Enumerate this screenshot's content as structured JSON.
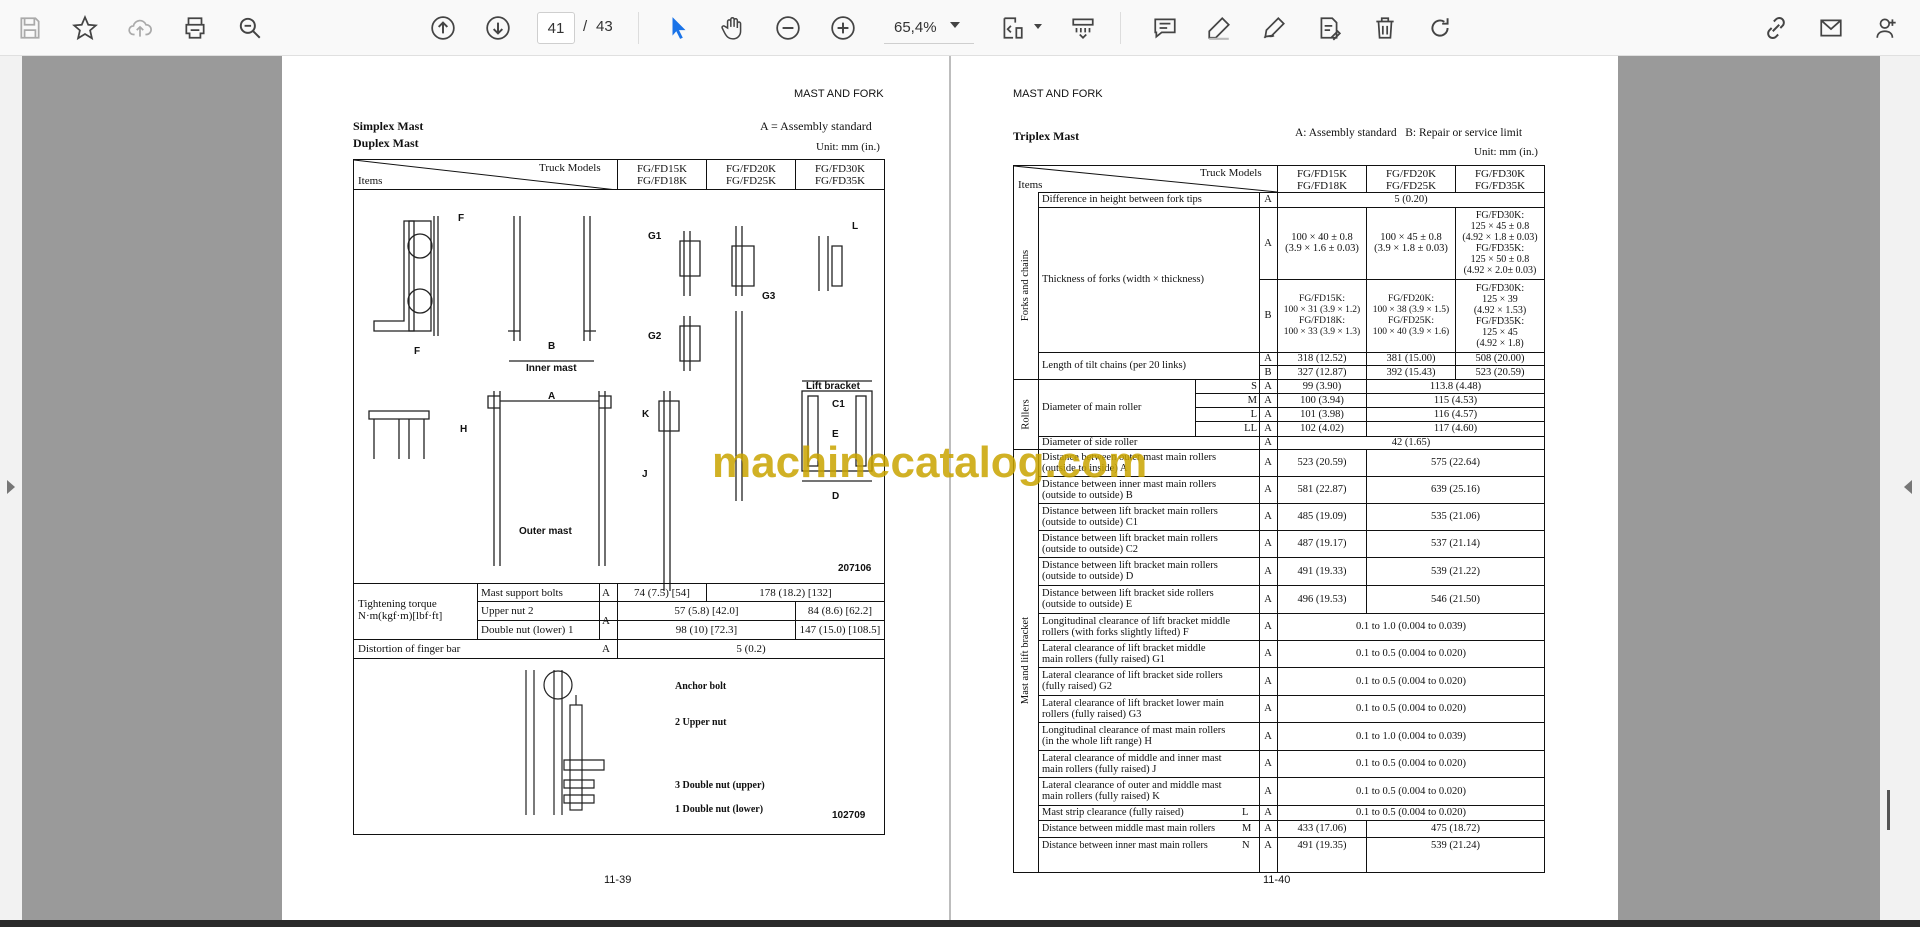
{
  "toolbar": {
    "page_current": "41",
    "page_separator": "/",
    "page_total": "43",
    "zoom": "65,4%"
  },
  "left_page": {
    "header": "MAST AND FORK",
    "title1": "Simplex Mast",
    "title2": "Duplex Mast",
    "std": "A = Assembly standard",
    "unit": "Unit: mm (in.)",
    "col_truck": "Truck Models",
    "col_items": "Items",
    "models": [
      [
        "FG/FD15K",
        "FG/FD18K"
      ],
      [
        "FG/FD20K",
        "FG/FD25K"
      ],
      [
        "FG/FD30K",
        "FG/FD35K"
      ]
    ],
    "fig_labels": {
      "F1": "F",
      "F2": "F",
      "B": "B",
      "inner": "Inner mast",
      "G1": "G1",
      "G3": "G3",
      "G2": "G2",
      "L": "L",
      "lift": "Lift bracket",
      "C1": "C1",
      "E": "E",
      "D": "D",
      "A": "A",
      "H": "H",
      "K": "K",
      "J": "J",
      "outer": "Outer mast",
      "code": "207106"
    },
    "torque_label": [
      "Tightening torque",
      "N·m(kgf·m)[lbf·ft]"
    ],
    "torque_rows": [
      {
        "name": "Mast support bolts",
        "std": "A",
        "v1": "74 (7.5) [54]",
        "v2": "178 (18.2) [132]"
      },
      {
        "name": "Upper nut 2",
        "std": "A",
        "v1": "57 (5.8) [42.0]",
        "v2": "84 (8.6) [62.2]"
      },
      {
        "name": "Double nut (lower) 1",
        "std": "",
        "v1": "98 (10) [72.3]",
        "v2": "147 (15.0) [108.5]"
      }
    ],
    "distortion": {
      "name": "Distortion of finger bar",
      "std": "A",
      "value": "5 (0.2)"
    },
    "fig2": {
      "anchor": "Anchor bolt",
      "upper": "2 Upper nut",
      "dn_upper": "3 Double nut (upper)",
      "dn_lower": "1 Double nut (lower)",
      "code": "102709"
    },
    "footer": "11-39"
  },
  "right_page": {
    "header": "MAST AND FORK",
    "title": "Triplex Mast",
    "std": "A: Assembly standard   B: Repair or service limit",
    "unit": "Unit: mm (in.)",
    "col_truck": "Truck Models",
    "col_items": "Items",
    "models": [
      [
        "FG/FD15K",
        "FG/FD18K"
      ],
      [
        "FG/FD20K",
        "FG/FD25K"
      ],
      [
        "FG/FD30K",
        "FG/FD35K"
      ]
    ],
    "groups": {
      "forks": "Forks and chains",
      "rollers": "Rollers",
      "mast": "Mast and lift bracket"
    },
    "rows": {
      "r1": {
        "name": "Difference in height between fork tips",
        "std": "A",
        "value": "5 (0.20)"
      },
      "r2": {
        "name": "Thickness of forks (width × thickness)"
      },
      "r2a": {
        "std": "A",
        "v1": [
          "100 × 40 ± 0.8",
          "(3.9 × 1.6 ± 0.03)"
        ],
        "v2": [
          "100 × 45 ± 0.8",
          "(3.9 × 1.8 ± 0.03)"
        ],
        "v3": [
          "FG/FD30K:",
          "125 × 45 ± 0.8",
          "(4.92 × 1.8 ± 0.03)",
          "FG/FD35K:",
          "125 × 50 ± 0.8",
          "(4.92 × 2.0± 0.03)"
        ]
      },
      "r2b": {
        "std": "B",
        "v1": [
          "FG/FD15K:",
          "100 × 31 (3.9 × 1.2)",
          "FG/FD18K:",
          "100 × 33 (3.9 × 1.3)"
        ],
        "v2": [
          "FG/FD20K:",
          "100 × 38 (3.9 × 1.5)",
          "FG/FD25K:",
          "100 × 40 (3.9 × 1.6)"
        ],
        "v3": [
          "FG/FD30K:",
          "125 × 39",
          "(4.92 × 1.53)",
          "FG/FD35K:",
          "125 × 45",
          "(4.92 × 1.8)"
        ]
      },
      "r3": {
        "name": "Length of tilt chains (per 20 links)",
        "a": [
          "A",
          "318 (12.52)",
          "381 (15.00)",
          "508 (20.00)"
        ],
        "b": [
          "B",
          "327 (12.87)",
          "392 (15.43)",
          "523 (20.59)"
        ]
      },
      "r4": {
        "name": "Diameter of main roller",
        "sizes": [
          [
            "S",
            "A",
            "99 (3.90)",
            "113.8 (4.48)"
          ],
          [
            "M",
            "A",
            "100 (3.94)",
            "115 (4.53)"
          ],
          [
            "L",
            "A",
            "101 (3.98)",
            "116 (4.57)"
          ],
          [
            "LL",
            "A",
            "102  (4.02)",
            "117 (4.60)"
          ]
        ]
      },
      "r5": {
        "name": "Diameter of side roller",
        "std": "A",
        "value": "42 (1.65)"
      },
      "list": [
        {
          "name": [
            "Distance between outer mast main rollers",
            "(outside to inside) A"
          ],
          "std": "A",
          "v1": "523 (20.59)",
          "v2": "575 (22.64)"
        },
        {
          "name": [
            "Distance between inner mast main rollers",
            "(outside to outside) B"
          ],
          "std": "A",
          "v1": "581 (22.87)",
          "v2": "639 (25.16)"
        },
        {
          "name": [
            "Distance between lift bracket main rollers",
            "(outside to outside) C1"
          ],
          "std": "A",
          "v1": "485 (19.09)",
          "v2": "535 (21.06)"
        },
        {
          "name": [
            "Distance between lift bracket main rollers",
            "(outside to outside) C2"
          ],
          "std": "A",
          "v1": "487 (19.17)",
          "v2": "537 (21.14)"
        },
        {
          "name": [
            "Distance between lift bracket main rollers",
            "(outside to outside) D"
          ],
          "std": "A",
          "v1": "491 (19.33)",
          "v2": "539 (21.22)"
        },
        {
          "name": [
            "Distance between lift bracket side rollers",
            "(outside to outside) E"
          ],
          "std": "A",
          "v1": "496 (19.53)",
          "v2": "546 (21.50)"
        },
        {
          "name": [
            "Longitudinal clearance of lift bracket middle",
            "rollers (with forks slightly lifted) F"
          ],
          "std": "A",
          "all": "0.1 to 1.0 (0.004 to 0.039)"
        },
        {
          "name": [
            "Lateral clearance of lift bracket middle",
            "main rollers (fully raised) G1"
          ],
          "std": "A",
          "all": "0.1 to 0.5 (0.004 to 0.020)"
        },
        {
          "name": [
            "Lateral clearance of lift bracket side rollers",
            "(fully raised) G2"
          ],
          "std": "A",
          "all": "0.1 to 0.5 (0.004 to 0.020)"
        },
        {
          "name": [
            "Lateral clearance of lift bracket lower main",
            "rollers (fully raised) G3"
          ],
          "std": "A",
          "all": "0.1 to 0.5 (0.004 to 0.020)"
        },
        {
          "name": [
            "Longitudinal clearance of mast main rollers",
            "(in the whole lift range) H"
          ],
          "std": "A",
          "all": "0.1 to 1.0 (0.004 to 0.039)"
        },
        {
          "name": [
            "Lateral clearance of middle and inner mast",
            "main rollers (fully raised) J"
          ],
          "std": "A",
          "all": "0.1 to 0.5 (0.004 to 0.020)"
        },
        {
          "name": [
            "Lateral clearance of outer and middle mast",
            "main rollers (fully raised) K"
          ],
          "std": "A",
          "all": "0.1 to 0.5 (0.004 to 0.020)"
        }
      ],
      "r_strip": {
        "name": "Mast strip clearance (fully raised)",
        "letter": "L",
        "std": "A",
        "all": "0.1 to 0.5 (0.004 to 0.020)"
      },
      "r_mid": {
        "name": "Distance between middle mast main rollers",
        "letter": "M",
        "std": "A",
        "v1": "433 (17.06)",
        "v2": "475 (18.72)"
      },
      "r_inner": {
        "name": "Distance between inner mast main rollers",
        "letter": "N",
        "std": "A",
        "v1": "491 (19.35)",
        "v2": "539 (21.24)"
      }
    },
    "footer": "11-40"
  },
  "watermark": "machinecatalog.com"
}
